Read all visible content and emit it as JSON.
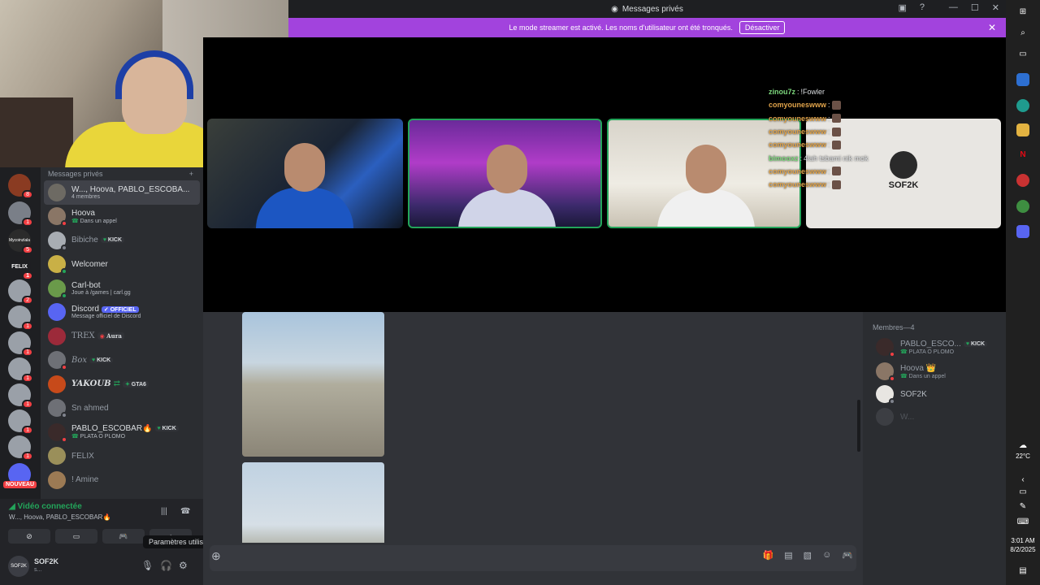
{
  "titlebar": {
    "title": "Messages privés"
  },
  "banner": {
    "text": "Le mode streamer est activé. Les noms d'utilisateur ont été tronqués.",
    "button": "Désactiver"
  },
  "rail": {
    "badges": [
      "8",
      "1",
      "5",
      "1",
      "2",
      "1",
      "1",
      "1",
      "1",
      "1",
      "1"
    ],
    "logos": [
      "Mycoinzlala",
      "FELIX"
    ],
    "new_label": "NOUVEAU"
  },
  "dmlist": {
    "header": "Messages privés",
    "items": [
      {
        "name": "W..., Hoova, PABLO_ESCOBA...",
        "sub": "4 membres"
      },
      {
        "name": "Hoova",
        "sub": "Dans un appel"
      },
      {
        "name": "Bibiche",
        "tag": "KICK"
      },
      {
        "name": "Welcomer"
      },
      {
        "name": "Carl-bot",
        "sub": "Joue à /games | carl.gg"
      },
      {
        "name": "Discord",
        "tag": "OFFICIEL",
        "sub": "Message officiel de Discord"
      },
      {
        "name": "TREX",
        "tag": "Aura"
      },
      {
        "name": "Box",
        "tag": "KICK"
      },
      {
        "name": "YAKOUB",
        "tag": "GTA6"
      },
      {
        "name": "Sn ahmed"
      },
      {
        "name": "PABLO_ESCOBAR🔥",
        "tag": "KICK",
        "sub": "PLATA O PLOMO"
      },
      {
        "name": "FELIX"
      },
      {
        "name": "! Amine"
      }
    ]
  },
  "voice": {
    "status": "Vidéo connectée",
    "members": "W..., Hoova, PABLO_ESCOBAR🔥"
  },
  "user": {
    "name": "SOF2K",
    "status": "s...",
    "avatar_text": "SOF2K",
    "tooltip": "Paramètres utilisateur"
  },
  "stage": {
    "logo": "SOF2K"
  },
  "chat": [
    {
      "user": "zinou7z",
      "color": "#7dd87d",
      "msg": "!Fowler"
    },
    {
      "user": "comyouneswww",
      "color": "#e0a34a",
      "msg": ""
    },
    {
      "user": "comyouneswww",
      "color": "#e0a34a",
      "msg": ""
    },
    {
      "user": "comyouneswww",
      "color": "#e0a34a",
      "msg": ""
    },
    {
      "user": "comyouneswww",
      "color": "#e0a34a",
      "msg": ""
    },
    {
      "user": "bimooxz",
      "color": "#7dd87d",
      "msg": "4lah tsbami nik mok"
    },
    {
      "user": "comyouneswww",
      "color": "#e0a34a",
      "msg": ""
    },
    {
      "user": "comyouneswww",
      "color": "#e0a34a",
      "msg": ""
    }
  ],
  "members": {
    "header": "Membres—4",
    "items": [
      {
        "name": "PABLO_ESCO...",
        "tag": "KICK",
        "sub": "PLATA O PLOMO"
      },
      {
        "name": "Hoova 👑",
        "sub": "Dans un appel"
      },
      {
        "name": "SOF2K"
      },
      {
        "name": "W..."
      }
    ]
  },
  "taskbar": {
    "temp": "22°C",
    "time": "3:01 AM",
    "date": "8/2/2025"
  },
  "colors": {
    "accent": "#a243dd",
    "online": "#23a55a",
    "dnd": "#f23f43"
  }
}
